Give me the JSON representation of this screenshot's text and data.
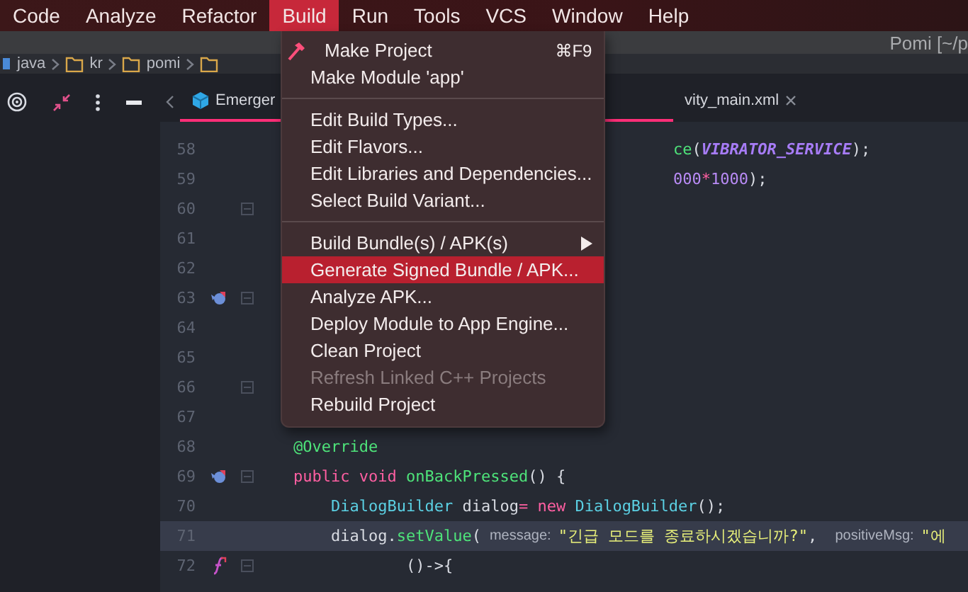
{
  "menu_bar": [
    {
      "label": "Code",
      "selected": false
    },
    {
      "label": "Analyze",
      "selected": false
    },
    {
      "label": "Refactor",
      "selected": false
    },
    {
      "label": "Build",
      "selected": true
    },
    {
      "label": "Run",
      "selected": false
    },
    {
      "label": "Tools",
      "selected": false
    },
    {
      "label": "VCS",
      "selected": false
    },
    {
      "label": "Window",
      "selected": false
    },
    {
      "label": "Help",
      "selected": false
    }
  ],
  "title_bar": {
    "title": "Pomi [~/p"
  },
  "breadcrumb": [
    "java",
    "kr",
    "pomi"
  ],
  "editor_tabs": [
    {
      "label": "Emerger",
      "selected": true,
      "closable": false
    },
    {
      "label": "vity_main.xml",
      "selected": false,
      "closable": true
    }
  ],
  "build_menu": {
    "items": [
      {
        "kind": "icon_item",
        "label": "Make Project",
        "shortcut": "⌘F9",
        "selected": false,
        "disabled": false
      },
      {
        "kind": "item",
        "label": "Make Module 'app'",
        "selected": false,
        "disabled": false
      },
      {
        "kind": "separator"
      },
      {
        "kind": "item",
        "label": "Edit Build Types...",
        "selected": false,
        "disabled": false
      },
      {
        "kind": "item",
        "label": "Edit Flavors...",
        "selected": false,
        "disabled": false
      },
      {
        "kind": "item",
        "label": "Edit Libraries and Dependencies...",
        "selected": false,
        "disabled": false
      },
      {
        "kind": "item",
        "label": "Select Build Variant...",
        "selected": false,
        "disabled": false
      },
      {
        "kind": "separator"
      },
      {
        "kind": "submenu",
        "label": "Build Bundle(s) / APK(s)",
        "selected": false,
        "disabled": false
      },
      {
        "kind": "item",
        "label": "Generate Signed Bundle / APK...",
        "selected": true,
        "disabled": false
      },
      {
        "kind": "item",
        "label": "Analyze APK...",
        "selected": false,
        "disabled": false
      },
      {
        "kind": "item",
        "label": "Deploy Module to App Engine...",
        "selected": false,
        "disabled": false
      },
      {
        "kind": "item",
        "label": "Clean Project",
        "selected": false,
        "disabled": false
      },
      {
        "kind": "item",
        "label": "Refresh Linked C++ Projects",
        "selected": false,
        "disabled": true
      },
      {
        "kind": "item",
        "label": "Rebuild Project",
        "selected": false,
        "disabled": false
      }
    ]
  },
  "code_lines": [
    {
      "number": "58",
      "clipped": true,
      "current": false,
      "fold": false,
      "tokens": [
        {
          "kind": "func",
          "text": "ce"
        },
        {
          "kind": "plain",
          "text": "("
        },
        {
          "kind": "const",
          "text": "VIBRATOR_SERVICE"
        },
        {
          "kind": "plain",
          "text": ");"
        }
      ]
    },
    {
      "number": "59",
      "clipped": true,
      "current": false,
      "fold": false,
      "tokens": [
        {
          "kind": "number",
          "text": "000"
        },
        {
          "kind": "op",
          "text": "*"
        },
        {
          "kind": "number",
          "text": "1000"
        },
        {
          "kind": "plain",
          "text": ");"
        }
      ]
    },
    {
      "number": "60",
      "current": false,
      "fold": true
    },
    {
      "number": "61",
      "current": false,
      "fold": false
    },
    {
      "number": "62",
      "current": false,
      "fold": false
    },
    {
      "number": "63",
      "current": false,
      "fold": true,
      "marker": {
        "kind": "override"
      }
    },
    {
      "number": "64",
      "current": false,
      "fold": false
    },
    {
      "number": "65",
      "current": false,
      "fold": false
    },
    {
      "number": "66",
      "current": false,
      "fold": true
    },
    {
      "number": "67",
      "current": false,
      "fold": false
    },
    {
      "number": "68",
      "clipped": false,
      "current": false,
      "fold": false,
      "tokens": [
        {
          "kind": "annotation",
          "text": "@Override"
        }
      ]
    },
    {
      "number": "69",
      "clipped": false,
      "current": false,
      "fold": true,
      "marker": {
        "kind": "override"
      },
      "tokens": [
        {
          "kind": "keyword",
          "text": "public"
        },
        {
          "kind": "keyword",
          "text": " void"
        },
        {
          "kind": "func",
          "text": " onBackPressed"
        },
        {
          "kind": "plain",
          "text": "() {"
        }
      ]
    },
    {
      "number": "70",
      "clipped": false,
      "current": false,
      "fold": false,
      "tokens": [
        {
          "kind": "type",
          "text": "    DialogBuilder"
        },
        {
          "kind": "plain",
          "text": " dialog"
        },
        {
          "kind": "op",
          "text": "="
        },
        {
          "kind": "keyword",
          "text": " new"
        },
        {
          "kind": "type",
          "text": " DialogBuilder"
        },
        {
          "kind": "plain",
          "text": "();"
        }
      ]
    },
    {
      "number": "71",
      "clipped": false,
      "current": true,
      "fold": false,
      "tokens": [
        {
          "kind": "plain",
          "text": "    dialog."
        },
        {
          "kind": "func",
          "text": "setValue"
        },
        {
          "kind": "plain",
          "text": "("
        },
        {
          "kind": "hint",
          "text": "message:"
        },
        {
          "kind": "string",
          "text": "\"긴급 모드를 종료하시겠습니까?\""
        },
        {
          "kind": "plain",
          "text": ", "
        },
        {
          "kind": "hint",
          "text": "positiveMsg:"
        },
        {
          "kind": "string",
          "text": "\"에"
        }
      ]
    },
    {
      "number": "72",
      "clipped": false,
      "current": false,
      "fold": true,
      "marker": {
        "kind": "lambda"
      },
      "tokens": [
        {
          "kind": "plain",
          "text": "            ()->{"
        }
      ]
    }
  ]
}
